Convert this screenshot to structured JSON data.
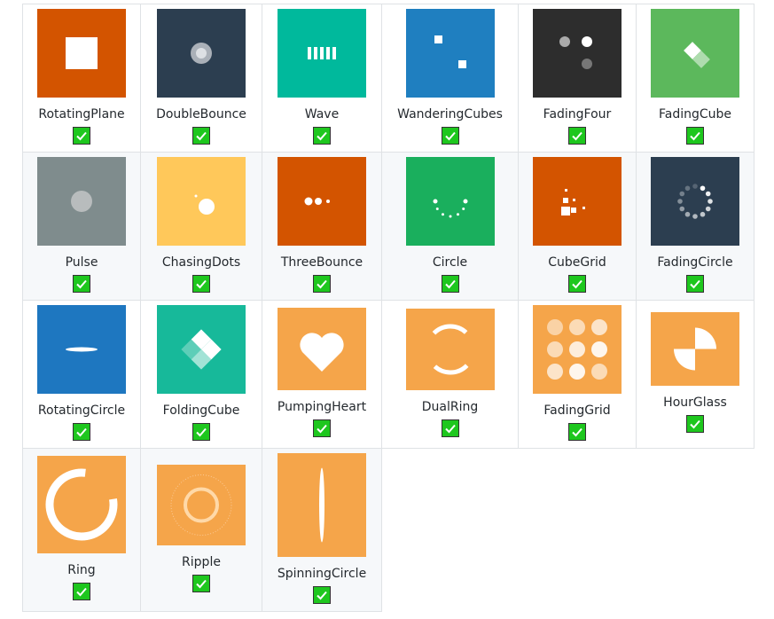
{
  "spinners": [
    {
      "name": "RotatingPlane",
      "icon": "rotating-plane",
      "color": "#d35400",
      "checked": true
    },
    {
      "name": "DoubleBounce",
      "icon": "double-bounce",
      "color": "#2c3e50",
      "checked": true
    },
    {
      "name": "Wave",
      "icon": "wave",
      "color": "#00b99c",
      "checked": true
    },
    {
      "name": "WanderingCubes",
      "icon": "wandering-cubes",
      "color": "#1f7fc0",
      "checked": true
    },
    {
      "name": "FadingFour",
      "icon": "fading-four",
      "color": "#2d2d2d",
      "checked": true
    },
    {
      "name": "FadingCube",
      "icon": "fading-cube",
      "color": "#5cb85c",
      "checked": true
    },
    {
      "name": "Pulse",
      "icon": "pulse",
      "color": "#7f8c8d",
      "checked": true
    },
    {
      "name": "ChasingDots",
      "icon": "chasing-dots",
      "color": "#ffc85a",
      "checked": true
    },
    {
      "name": "ThreeBounce",
      "icon": "three-bounce",
      "color": "#d35400",
      "checked": true
    },
    {
      "name": "Circle",
      "icon": "circle",
      "color": "#1aaf5d",
      "checked": true
    },
    {
      "name": "CubeGrid",
      "icon": "cube-grid",
      "color": "#d35400",
      "checked": true
    },
    {
      "name": "FadingCircle",
      "icon": "fading-circle",
      "color": "#2c3e50",
      "checked": true
    },
    {
      "name": "RotatingCircle",
      "icon": "rotating-circle",
      "color": "#1e77c0",
      "checked": true
    },
    {
      "name": "FoldingCube",
      "icon": "folding-cube",
      "color": "#17b99a",
      "checked": true
    },
    {
      "name": "PumpingHeart",
      "icon": "pumping-heart",
      "color": "#f5a54a",
      "checked": true
    },
    {
      "name": "DualRing",
      "icon": "dual-ring",
      "color": "#f5a54a",
      "checked": true
    },
    {
      "name": "FadingGrid",
      "icon": "fading-grid",
      "color": "#f5a54a",
      "checked": true
    },
    {
      "name": "HourGlass",
      "icon": "hour-glass",
      "color": "#f5a54a",
      "checked": true
    },
    {
      "name": "Ring",
      "icon": "ring",
      "color": "#f5a54a",
      "checked": true
    },
    {
      "name": "Ripple",
      "icon": "ripple",
      "color": "#f5a54a",
      "checked": true
    },
    {
      "name": "SpinningCircle",
      "icon": "spinning-circle",
      "color": "#f5a54a",
      "checked": true
    }
  ]
}
